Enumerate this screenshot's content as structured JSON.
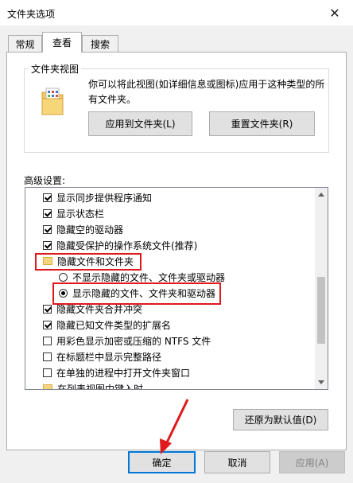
{
  "window": {
    "title": "文件夹选项",
    "close_icon": "close-icon"
  },
  "tabs": [
    {
      "label": "常规",
      "active": false
    },
    {
      "label": "查看",
      "active": true
    },
    {
      "label": "搜索",
      "active": false
    }
  ],
  "folder_views": {
    "group_label": "文件夹视图",
    "description": "你可以将此视图(如详细信息或图标)应用于这种类型的所有文件夹。",
    "apply_button": "应用到文件夹(L)",
    "reset_button": "重置文件夹(R)"
  },
  "advanced": {
    "label": "高级设置:",
    "items": [
      {
        "type": "checkbox",
        "checked": true,
        "label": "显示同步提供程序通知"
      },
      {
        "type": "checkbox",
        "checked": true,
        "label": "显示状态栏"
      },
      {
        "type": "checkbox",
        "checked": true,
        "label": "隐藏空的驱动器"
      },
      {
        "type": "checkbox",
        "checked": true,
        "label": "隐藏受保护的操作系统文件(推荐)"
      },
      {
        "type": "folder",
        "label": "隐藏文件和文件夹"
      },
      {
        "type": "radio",
        "selected": false,
        "label": "不显示隐藏的文件、文件夹或驱动器"
      },
      {
        "type": "radio",
        "selected": true,
        "label": "显示隐藏的文件、文件夹和驱动器"
      },
      {
        "type": "checkbox",
        "checked": true,
        "label": "隐藏文件夹合并冲突"
      },
      {
        "type": "checkbox",
        "checked": true,
        "label": "隐藏已知文件类型的扩展名"
      },
      {
        "type": "checkbox",
        "checked": false,
        "label": "用彩色显示加密或压缩的 NTFS 文件"
      },
      {
        "type": "checkbox",
        "checked": false,
        "label": "在标题栏中显示完整路径"
      },
      {
        "type": "checkbox",
        "checked": false,
        "label": "在单独的进程中打开文件夹窗口"
      },
      {
        "type": "folder",
        "label": "在列表视图中键入时"
      }
    ],
    "restore_button": "还原为默认值(D)"
  },
  "footer": {
    "ok_button": "确定",
    "cancel_button": "取消",
    "apply_button": "应用(A)"
  },
  "colors": {
    "annotation_red": "#e0191c",
    "focus_blue": "#0078d7"
  }
}
